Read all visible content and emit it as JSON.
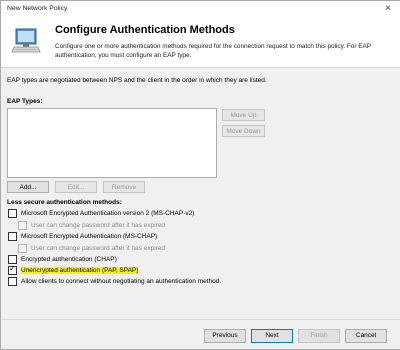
{
  "window": {
    "title": "New Network Policy",
    "close_glyph": "×"
  },
  "header": {
    "title": "Configure Authentication Methods",
    "description": "Configure one or more authentication methods required for the connection request to match this policy. For EAP authentication, you must configure an EAP type."
  },
  "eap": {
    "note": "EAP types are negotiated between NPS and the client in the order in which they are listed.",
    "types_label": "EAP Types:",
    "move_up": "Move Up",
    "move_down": "Move Down",
    "add": "Add...",
    "edit": "Edit...",
    "remove": "Remove"
  },
  "less_secure": {
    "label": "Less secure authentication methods:",
    "items": [
      {
        "label": "Microsoft Encrypted Authentication version 2 (MS-CHAP-v2)",
        "checked": false,
        "disabled": false
      },
      {
        "label": "User can change password after it has expired",
        "checked": false,
        "disabled": true
      },
      {
        "label": "Microsoft Encrypted Authentication (MS-CHAP)",
        "checked": false,
        "disabled": false
      },
      {
        "label": "User can change password after it has expired",
        "checked": false,
        "disabled": true
      },
      {
        "label": "Encrypted authentication (CHAP)",
        "checked": false,
        "disabled": false
      },
      {
        "label": "Unencrypted authentication (PAP, SPAP)",
        "checked": true,
        "disabled": false,
        "highlighted": true
      },
      {
        "label": "Allow clients to connect without negotiating an authentication method.",
        "checked": false,
        "disabled": false
      }
    ]
  },
  "footer": {
    "previous": "Previous",
    "next": "Next",
    "finish": "Finish",
    "cancel": "Cancel"
  },
  "colors": {
    "highlight": "#fff200",
    "focus_border": "#0078d7"
  },
  "icons": {
    "header": "network-policy-monitor-icon"
  }
}
